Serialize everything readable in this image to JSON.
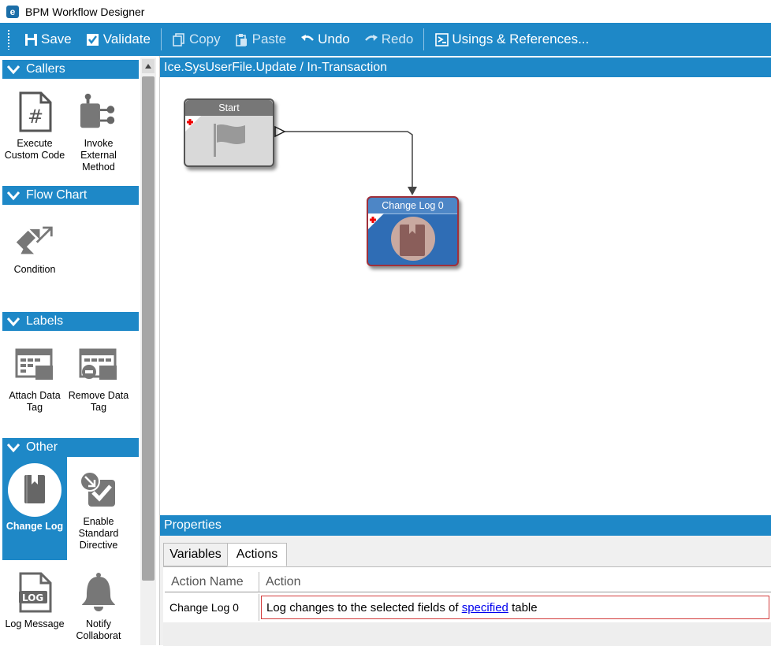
{
  "window": {
    "title": "BPM Workflow Designer"
  },
  "toolbar": {
    "save": "Save",
    "validate": "Validate",
    "copy": "Copy",
    "paste": "Paste",
    "undo": "Undo",
    "redo": "Redo",
    "usings": "Usings & References..."
  },
  "sidebar": {
    "categories": [
      {
        "label": "Callers",
        "tools": [
          {
            "label": "Execute Custom Code",
            "icon": "hash-document-icon"
          },
          {
            "label": "Invoke External Method",
            "icon": "method-connector-icon"
          }
        ]
      },
      {
        "label": "Flow Chart",
        "tools": [
          {
            "label": "Condition",
            "icon": "condition-arrows-icon"
          }
        ]
      },
      {
        "label": "Labels",
        "tools": [
          {
            "label": "Attach Data Tag",
            "icon": "attach-data-tag-icon"
          },
          {
            "label": "Remove Data Tag",
            "icon": "remove-data-tag-icon"
          }
        ]
      },
      {
        "label": "Other",
        "tools": [
          {
            "label": "Change Log",
            "icon": "change-log-book-icon"
          },
          {
            "label": "Enable Standard Directive",
            "icon": "enable-directive-icon"
          },
          {
            "label": "Log Message",
            "icon": "log-message-icon"
          },
          {
            "label": "Notify Collaborat",
            "icon": "bell-icon"
          }
        ]
      }
    ]
  },
  "canvas": {
    "title": "Ice.SysUserFile.Update / In-Transaction",
    "nodes": {
      "start": "Start",
      "change_log": "Change Log 0"
    }
  },
  "properties": {
    "title": "Properties",
    "tabs": [
      "Variables",
      "Actions"
    ],
    "active_tab": "Actions",
    "columns": [
      "Action Name",
      "Action"
    ],
    "row": {
      "name": "Change Log 0",
      "action_prefix": "Log changes to the selected fields of",
      "action_link": "specified",
      "action_suffix": "table"
    }
  },
  "colors": {
    "accent": "#1e88c7",
    "selected_node_border": "#a0303a",
    "node_blue": "#2f6db5"
  }
}
